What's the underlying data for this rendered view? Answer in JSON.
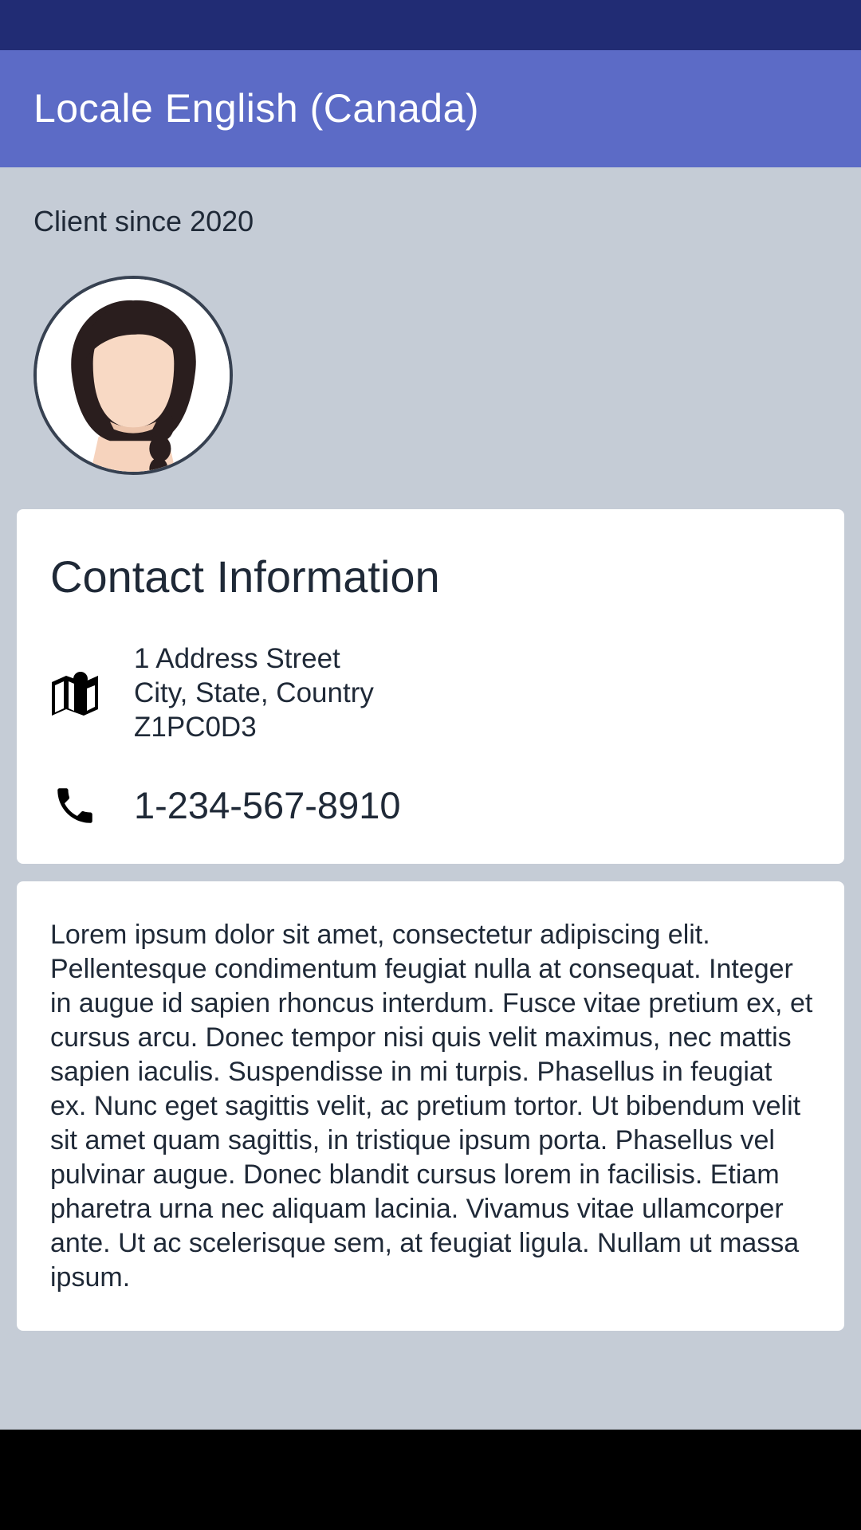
{
  "app_bar": {
    "title": "Locale English (Canada)"
  },
  "profile": {
    "client_since": "Client since 2020",
    "avatar_icon": "avatar-woman-braid"
  },
  "contact_card": {
    "title": "Contact Information",
    "address_icon": "map-icon",
    "address_lines": [
      "1 Address Street",
      "City, State, Country",
      "Z1PC0D3"
    ],
    "phone_icon": "phone-icon",
    "phone_number": "1-234-567-8910"
  },
  "about_card": {
    "text": "Lorem ipsum dolor sit amet, consectetur adipiscing elit. Pellentesque condimentum feugiat nulla at consequat. Integer in augue id sapien rhoncus interdum. Fusce vitae pretium ex, et cursus arcu. Donec tempor nisi quis velit maximus, nec mattis sapien iaculis. Suspendisse in mi turpis. Phasellus in feugiat ex. Nunc eget sagittis velit, ac pretium tortor. Ut bibendum velit sit amet quam sagittis, in tristique ipsum porta. Phasellus vel pulvinar augue. Donec blandit cursus lorem in facilisis. Etiam pharetra urna nec aliquam lacinia. Vivamus vitae ullamcorper ante. Ut ac scelerisque sem, at feugiat ligula. Nullam ut massa ipsum."
  },
  "colors": {
    "status_bar": "#212c74",
    "app_bar": "#5c6bc6",
    "background": "#c5ccd6",
    "card": "#ffffff",
    "text": "#1f2937"
  }
}
